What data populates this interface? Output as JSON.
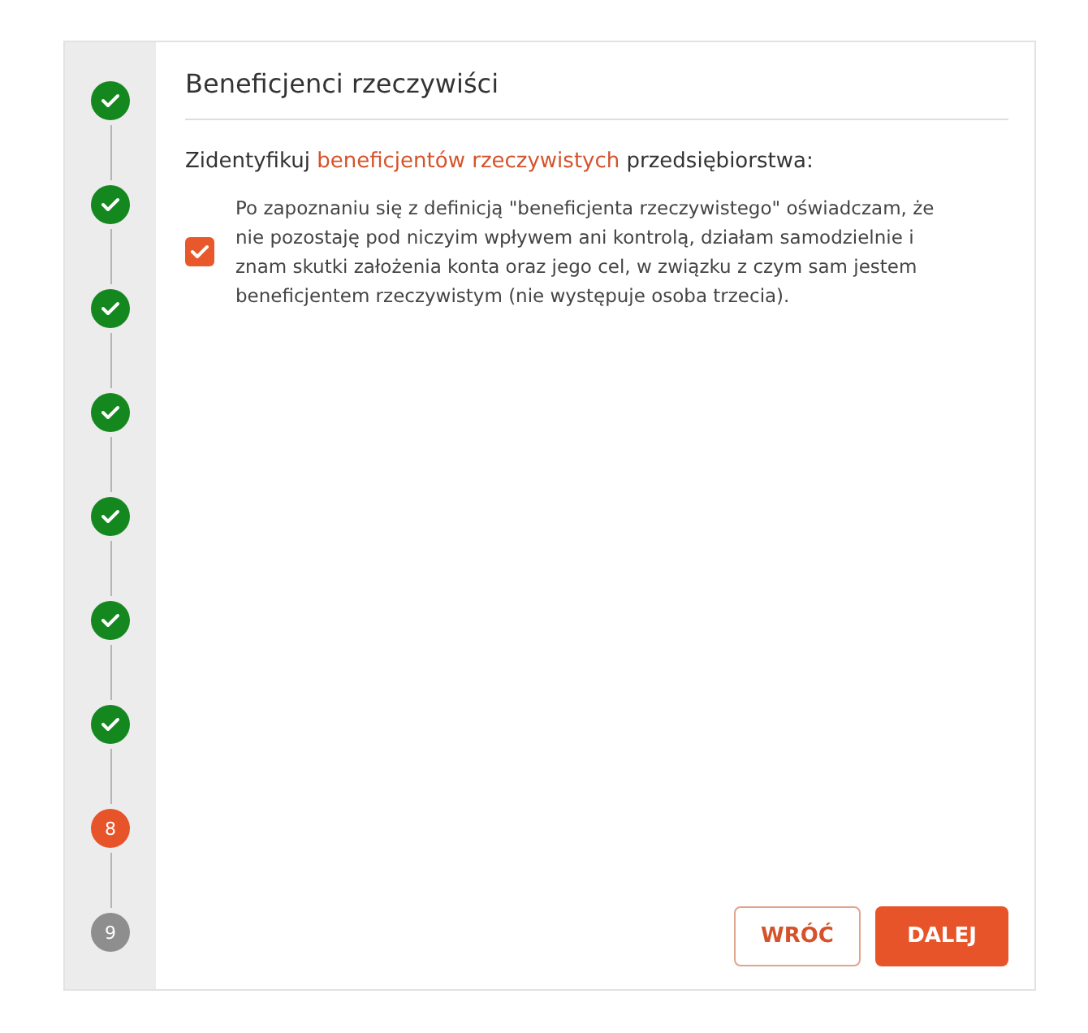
{
  "steps": [
    {
      "kind": "done"
    },
    {
      "kind": "done"
    },
    {
      "kind": "done"
    },
    {
      "kind": "done"
    },
    {
      "kind": "done"
    },
    {
      "kind": "done"
    },
    {
      "kind": "done"
    },
    {
      "kind": "current",
      "label": "8"
    },
    {
      "kind": "pending",
      "label": "9"
    }
  ],
  "title": "Beneficjenci rzeczywiści",
  "intro": {
    "before": "Zidentyfikuj ",
    "link": "beneficjentów rzeczywistych",
    "after": " przedsiębiorstwa:"
  },
  "declaration": {
    "checked": true,
    "text": "Po zapoznaniu się z definicją \"beneficjenta rzeczywistego\" oświadczam, że nie pozostaję pod niczyim wpływem ani kontrolą, działam samodzielnie i znam skutki założenia konta oraz jego cel, w związku z czym sam jestem beneficjentem rzeczywistym (nie występuje osoba trzecia)."
  },
  "buttons": {
    "back": "WRÓĆ",
    "next": "DALEJ"
  }
}
